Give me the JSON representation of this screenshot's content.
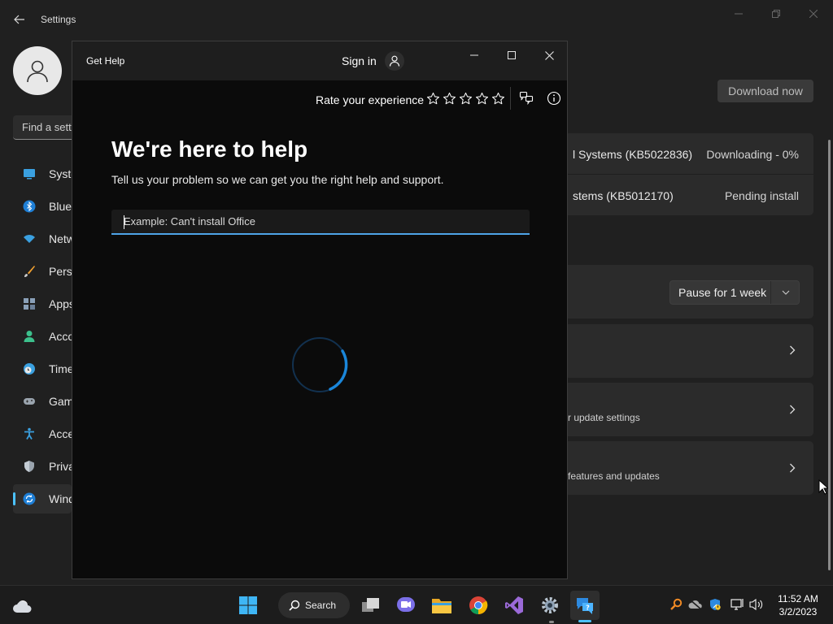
{
  "settings": {
    "title": "Settings",
    "search_placeholder": "Find a setting",
    "nav_items": [
      {
        "label": "System",
        "icon": "monitor-icon"
      },
      {
        "label": "Bluetooth & devices",
        "icon": "bluetooth-icon"
      },
      {
        "label": "Network & internet",
        "icon": "wifi-icon"
      },
      {
        "label": "Personalization",
        "icon": "brush-icon"
      },
      {
        "label": "Apps",
        "icon": "apps-icon"
      },
      {
        "label": "Accounts",
        "icon": "person-icon"
      },
      {
        "label": "Time & language",
        "icon": "clock-globe-icon"
      },
      {
        "label": "Gaming",
        "icon": "gamepad-icon"
      },
      {
        "label": "Accessibility",
        "icon": "accessibility-icon"
      },
      {
        "label": "Privacy & security",
        "icon": "shield-icon"
      },
      {
        "label": "Windows Update",
        "icon": "update-icon"
      }
    ],
    "download_now": "Download now",
    "updates": [
      {
        "name": "l Systems (KB5022836)",
        "status": "Downloading - 0%"
      },
      {
        "name": "stems (KB5012170)",
        "status": "Pending install"
      }
    ],
    "pause_label": "Pause for 1 week",
    "advanced_sub": "r update settings",
    "insider_sub": "features and updates"
  },
  "gethelp": {
    "title": "Get Help",
    "signin": "Sign in",
    "rate_label": "Rate your experience",
    "heading": "We're here to help",
    "subtext": "Tell us your problem so we can get you the right help and support.",
    "input_placeholder": "Example: Can't install Office",
    "input_value": ""
  },
  "taskbar": {
    "search_label": "Search",
    "time": "11:52 AM",
    "date": "3/2/2023"
  },
  "colors": {
    "accent": "#4cc2ff",
    "spinner": "#1a86d9"
  }
}
